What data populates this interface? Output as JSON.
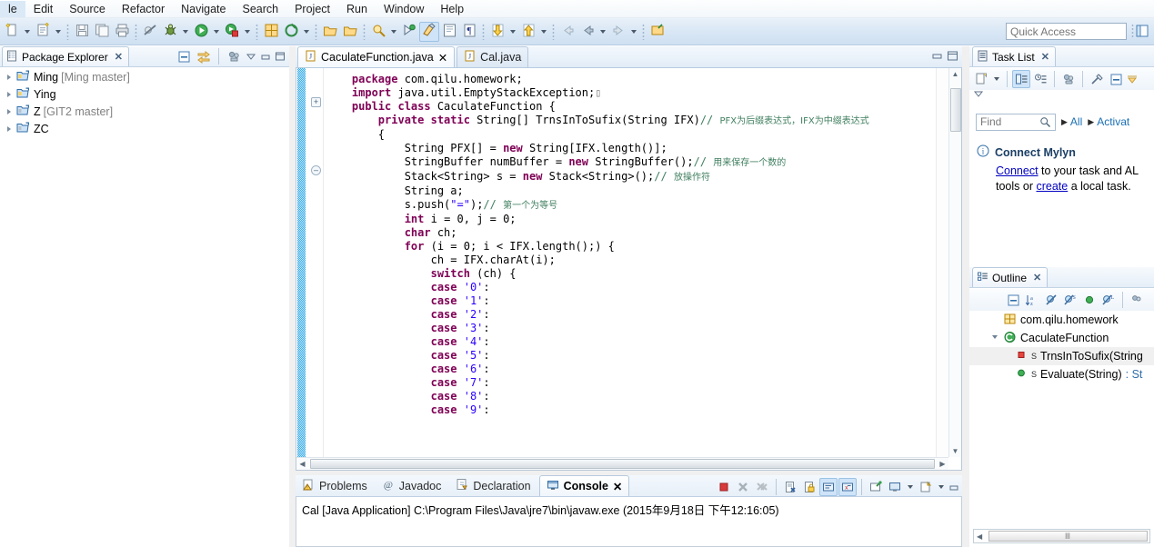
{
  "menu": {
    "items": [
      "le",
      "Edit",
      "Source",
      "Refactor",
      "Navigate",
      "Search",
      "Project",
      "Run",
      "Window",
      "Help"
    ]
  },
  "toolbar": {
    "quick_access_placeholder": "Quick Access",
    "groups": [
      {
        "name": "new-wizard",
        "icon": "new-file-icon",
        "has_arrow": true
      },
      {
        "name": "new-java-class",
        "icon": "new-class-icon",
        "has_arrow": true
      },
      {
        "name": "save",
        "icon": "save-icon",
        "has_arrow": false
      },
      {
        "name": "save-all",
        "icon": "save-all-icon",
        "has_arrow": false
      },
      {
        "name": "print",
        "icon": "print-icon",
        "has_arrow": false
      },
      {
        "name": "toggle-breakpoint",
        "icon": "skip-breakpoints-icon",
        "has_arrow": false
      },
      {
        "name": "debug",
        "icon": "debug-bug-icon",
        "has_arrow": true
      },
      {
        "name": "run",
        "icon": "run-play-icon",
        "has_arrow": true
      },
      {
        "name": "run-coverage",
        "icon": "coverage-icon",
        "has_arrow": true
      },
      {
        "name": "new-java-project",
        "icon": "java-project-icon",
        "has_arrow": false
      },
      {
        "name": "external-tools",
        "icon": "external-tools-icon",
        "has_arrow": true
      },
      {
        "name": "open-type",
        "icon": "open-type-icon",
        "has_arrow": false
      },
      {
        "name": "open-task",
        "icon": "open-task-icon",
        "has_arrow": false
      },
      {
        "name": "search",
        "icon": "search-icon",
        "has_arrow": true
      },
      {
        "name": "next-annotation",
        "icon": "next-annotation-icon",
        "has_arrow": false
      },
      {
        "name": "toggle-mark-occurrences",
        "icon": "mark-occurrences-icon",
        "has_arrow": false
      },
      {
        "name": "show-whitespace",
        "icon": "whitespace-icon",
        "has_arrow": false
      },
      {
        "name": "show-source-quick",
        "icon": "source-icon",
        "has_arrow": false
      },
      {
        "name": "next-edit",
        "icon": "down-arrow-yellow-icon",
        "has_arrow": true
      },
      {
        "name": "prev-edit",
        "icon": "up-arrow-yellow-icon",
        "has_arrow": true
      },
      {
        "name": "back",
        "icon": "back-arrow-icon",
        "has_arrow": false
      },
      {
        "name": "back-history",
        "icon": "back-arrow-active-icon",
        "has_arrow": true
      },
      {
        "name": "forward",
        "icon": "forward-arrow-icon",
        "has_arrow": true
      },
      {
        "name": "pin-editor",
        "icon": "pin-editor-icon",
        "has_arrow": false
      }
    ]
  },
  "package_explorer": {
    "title": "Package Explorer",
    "icon": "package-explorer-icon",
    "close_label": "✕",
    "toolbar": [
      {
        "name": "collapse-all",
        "icon": "collapse-all-icon"
      },
      {
        "name": "link-with-editor",
        "icon": "link-editor-icon"
      },
      {
        "name": "view-menu-filters",
        "icon": "filters-icon"
      },
      {
        "name": "view-menu",
        "icon": "view-menu-icon"
      },
      {
        "name": "minimize",
        "icon": "minimize-icon"
      },
      {
        "name": "maximize",
        "icon": "maximize-icon"
      }
    ],
    "tree": [
      {
        "label": "Ming",
        "branch": "[Ming master]",
        "icon": "java-project-closed-icon"
      },
      {
        "label": "Ying",
        "branch": "",
        "icon": "java-project-closed-icon"
      },
      {
        "label": "Z",
        "branch": "[GIT2 master]",
        "icon": "java-project-closed-icon"
      },
      {
        "label": "ZC",
        "branch": "",
        "icon": "java-project-closed-icon"
      }
    ]
  },
  "editor": {
    "tabs": [
      {
        "label": "CaculateFunction.java",
        "icon": "java-file-icon",
        "selected": true,
        "close_label": "✕"
      },
      {
        "label": "Cal.java",
        "icon": "java-file-icon",
        "selected": false,
        "close_label": ""
      }
    ],
    "minimize_label": "minimize",
    "maximize_label": "maximize",
    "code_lines": [
      {
        "indent": 1,
        "segments": [
          {
            "t": "package",
            "c": "kw"
          },
          {
            "t": " com.qilu.homework;",
            "c": ""
          }
        ]
      },
      {
        "indent": 0,
        "segments": []
      },
      {
        "indent": 1,
        "segments": [
          {
            "t": "import",
            "c": "kw"
          },
          {
            "t": " java.util.EmptyStackException;",
            "c": ""
          },
          {
            "t": "▯",
            "c": "dim"
          }
        ],
        "fold": "plus"
      },
      {
        "indent": 0,
        "segments": []
      },
      {
        "indent": 1,
        "segments": [
          {
            "t": "public class",
            "c": "kw"
          },
          {
            "t": " CaculateFunction {",
            "c": ""
          }
        ]
      },
      {
        "indent": 2,
        "segments": [
          {
            "t": "private static",
            "c": "kw"
          },
          {
            "t": " String[] TrnsInToSufix(String IFX)",
            "c": ""
          },
          {
            "t": "// ",
            "c": "cm"
          },
          {
            "t": "PFX为后缀表达式，IFX为中缀表达式",
            "c": "cmcjk"
          }
        ],
        "fold": "minus"
      },
      {
        "indent": 2,
        "segments": [
          {
            "t": "{",
            "c": ""
          }
        ]
      },
      {
        "indent": 3,
        "segments": [
          {
            "t": "String PFX[] = ",
            "c": ""
          },
          {
            "t": "new",
            "c": "kw"
          },
          {
            "t": " String[IFX.length()];",
            "c": ""
          }
        ]
      },
      {
        "indent": 3,
        "segments": [
          {
            "t": "StringBuffer numBuffer = ",
            "c": ""
          },
          {
            "t": "new",
            "c": "kw"
          },
          {
            "t": " StringBuffer();",
            "c": ""
          },
          {
            "t": "// ",
            "c": "cm"
          },
          {
            "t": "用来保存一个数的",
            "c": "cmcjk"
          }
        ]
      },
      {
        "indent": 3,
        "segments": [
          {
            "t": "Stack<String> s = ",
            "c": ""
          },
          {
            "t": "new",
            "c": "kw"
          },
          {
            "t": " Stack<String>();",
            "c": ""
          },
          {
            "t": "// ",
            "c": "cm"
          },
          {
            "t": "放操作符",
            "c": "cmcjk"
          }
        ]
      },
      {
        "indent": 3,
        "segments": [
          {
            "t": "String a;",
            "c": ""
          }
        ]
      },
      {
        "indent": 3,
        "segments": [
          {
            "t": "s.push(",
            "c": ""
          },
          {
            "t": "\"=\"",
            "c": "str"
          },
          {
            "t": ");",
            "c": ""
          },
          {
            "t": "// ",
            "c": "cm"
          },
          {
            "t": "第一个为等号",
            "c": "cmcjk"
          }
        ]
      },
      {
        "indent": 3,
        "segments": [
          {
            "t": "int",
            "c": "kw"
          },
          {
            "t": " i = 0, j = 0;",
            "c": ""
          }
        ]
      },
      {
        "indent": 3,
        "segments": [
          {
            "t": "char",
            "c": "kw"
          },
          {
            "t": " ch;",
            "c": ""
          }
        ]
      },
      {
        "indent": 3,
        "segments": [
          {
            "t": "for",
            "c": "kw"
          },
          {
            "t": " (i = 0; i < IFX.length();) {",
            "c": ""
          }
        ]
      },
      {
        "indent": 4,
        "segments": [
          {
            "t": "ch = IFX.charAt(i);",
            "c": ""
          }
        ]
      },
      {
        "indent": 4,
        "segments": [
          {
            "t": "switch",
            "c": "kw"
          },
          {
            "t": " (ch) {",
            "c": ""
          }
        ]
      },
      {
        "indent": 4,
        "segments": [
          {
            "t": "case",
            "c": "kw"
          },
          {
            "t": " ",
            "c": ""
          },
          {
            "t": "'0'",
            "c": "str"
          },
          {
            "t": ":",
            "c": ""
          }
        ]
      },
      {
        "indent": 4,
        "segments": [
          {
            "t": "case",
            "c": "kw"
          },
          {
            "t": " ",
            "c": ""
          },
          {
            "t": "'1'",
            "c": "str"
          },
          {
            "t": ":",
            "c": ""
          }
        ]
      },
      {
        "indent": 4,
        "segments": [
          {
            "t": "case",
            "c": "kw"
          },
          {
            "t": " ",
            "c": ""
          },
          {
            "t": "'2'",
            "c": "str"
          },
          {
            "t": ":",
            "c": ""
          }
        ]
      },
      {
        "indent": 4,
        "segments": [
          {
            "t": "case",
            "c": "kw"
          },
          {
            "t": " ",
            "c": ""
          },
          {
            "t": "'3'",
            "c": "str"
          },
          {
            "t": ":",
            "c": ""
          }
        ]
      },
      {
        "indent": 4,
        "segments": [
          {
            "t": "case",
            "c": "kw"
          },
          {
            "t": " ",
            "c": ""
          },
          {
            "t": "'4'",
            "c": "str"
          },
          {
            "t": ":",
            "c": ""
          }
        ]
      },
      {
        "indent": 4,
        "segments": [
          {
            "t": "case",
            "c": "kw"
          },
          {
            "t": " ",
            "c": ""
          },
          {
            "t": "'5'",
            "c": "str"
          },
          {
            "t": ":",
            "c": ""
          }
        ]
      },
      {
        "indent": 4,
        "segments": [
          {
            "t": "case",
            "c": "kw"
          },
          {
            "t": " ",
            "c": ""
          },
          {
            "t": "'6'",
            "c": "str"
          },
          {
            "t": ":",
            "c": ""
          }
        ]
      },
      {
        "indent": 4,
        "segments": [
          {
            "t": "case",
            "c": "kw"
          },
          {
            "t": " ",
            "c": ""
          },
          {
            "t": "'7'",
            "c": "str"
          },
          {
            "t": ":",
            "c": ""
          }
        ]
      },
      {
        "indent": 4,
        "segments": [
          {
            "t": "case",
            "c": "kw"
          },
          {
            "t": " ",
            "c": ""
          },
          {
            "t": "'8'",
            "c": "str"
          },
          {
            "t": ":",
            "c": ""
          }
        ]
      },
      {
        "indent": 4,
        "segments": [
          {
            "t": "case",
            "c": "kw"
          },
          {
            "t": " ",
            "c": ""
          },
          {
            "t": "'9'",
            "c": "str"
          },
          {
            "t": ":",
            "c": ""
          }
        ]
      }
    ]
  },
  "task_list": {
    "title": "Task List",
    "icon": "task-list-icon",
    "close_label": "✕",
    "toolbar": [
      {
        "name": "new-task",
        "icon": "new-task-icon"
      },
      {
        "name": "new-task-menu",
        "icon": "chevron-down-icon"
      },
      {
        "name": "categorized-presentation",
        "icon": "categorized-icon"
      },
      {
        "name": "scheduled-presentation",
        "icon": "scheduled-icon"
      },
      {
        "name": "synchronize-changed",
        "icon": "synchronize-icon"
      },
      {
        "name": "focus-on-workweek",
        "icon": "focus-icon"
      },
      {
        "name": "collapse-all-tasks",
        "icon": "collapse-all-icon"
      },
      {
        "name": "view-menu",
        "icon": "view-menu-icon"
      }
    ],
    "find_placeholder": "Find",
    "find_icon": "search-icon",
    "filters": [
      "All",
      "Activat"
    ],
    "mylyn": {
      "info_icon": "info-icon",
      "title": "Connect Mylyn",
      "line1_link": "Connect",
      "line1_rest": " to your task and AL",
      "line2_prefix": "tools or ",
      "line2_link": "create",
      "line2_suffix": " a local task."
    }
  },
  "outline": {
    "title": "Outline",
    "icon": "outline-icon",
    "close_label": "✕",
    "toolbar": [
      {
        "name": "collapse-all",
        "icon": "collapse-all-icon"
      },
      {
        "name": "sort",
        "icon": "sort-az-icon"
      },
      {
        "name": "hide-fields",
        "icon": "hide-fields-icon"
      },
      {
        "name": "hide-static",
        "icon": "hide-static-icon"
      },
      {
        "name": "hide-non-public",
        "icon": "hide-nonpublic-icon"
      },
      {
        "name": "hide-local-types",
        "icon": "hide-local-types-icon"
      },
      {
        "name": "view-menu",
        "icon": "view-menu-icon"
      }
    ],
    "rows": [
      {
        "label": "com.qilu.homework",
        "icon": "package-icon",
        "twisty": "none",
        "indent": 0,
        "modifier": "",
        "selected": false,
        "type": ""
      },
      {
        "label": "CaculateFunction",
        "icon": "class-green-icon",
        "twisty": "open",
        "indent": 0,
        "modifier": "",
        "selected": false,
        "type": ""
      },
      {
        "label": "TrnsInToSufix(String",
        "icon": "method-private-icon",
        "twisty": "none",
        "indent": 1,
        "modifier": "S",
        "selected": true,
        "type": ""
      },
      {
        "label": "Evaluate(String)",
        "icon": "method-public-icon",
        "twisty": "none",
        "indent": 1,
        "modifier": "S",
        "selected": false,
        "type": " : St"
      }
    ],
    "scroll_thumb_label": "Ⅲ"
  },
  "console": {
    "tabs": [
      {
        "label": "Problems",
        "icon": "problems-icon",
        "selected": false,
        "close_label": ""
      },
      {
        "label": "Javadoc",
        "icon": "javadoc-icon",
        "selected": false,
        "close_label": ""
      },
      {
        "label": "Declaration",
        "icon": "declaration-icon",
        "selected": false,
        "close_label": ""
      },
      {
        "label": "Console",
        "icon": "console-icon",
        "selected": true,
        "close_label": "✕"
      }
    ],
    "toolbar": [
      {
        "name": "terminate",
        "icon": "terminate-red-square-icon"
      },
      {
        "name": "remove-launch",
        "icon": "remove-launch-icon"
      },
      {
        "name": "remove-all-terminated",
        "icon": "remove-all-icon"
      },
      {
        "name": "clear-console",
        "icon": "clear-console-icon"
      },
      {
        "name": "scroll-lock",
        "icon": "scroll-lock-icon"
      },
      {
        "name": "show-console-on-output",
        "icon": "show-console-stdout-icon"
      },
      {
        "name": "show-console-on-error",
        "icon": "show-console-stderr-icon"
      },
      {
        "name": "pin-console",
        "icon": "pin-console-icon"
      },
      {
        "name": "display-selected-console",
        "icon": "display-console-icon"
      },
      {
        "name": "display-console-menu",
        "icon": "chevron-down-icon"
      },
      {
        "name": "open-console",
        "icon": "open-console-icon"
      },
      {
        "name": "open-console-menu",
        "icon": "chevron-down-icon"
      },
      {
        "name": "minimize-console",
        "icon": "minimize-icon"
      }
    ],
    "output_line": "Cal [Java Application] C:\\Program Files\\Java\\jre7\\bin\\javaw.exe (2015年9月18日 下午12:16:05)"
  },
  "colors": {
    "keyword": "#7f0055",
    "comment": "#3f7f5f",
    "string": "#2a00ff",
    "accent_blue": "#3daee9",
    "link": "#0000c0"
  }
}
